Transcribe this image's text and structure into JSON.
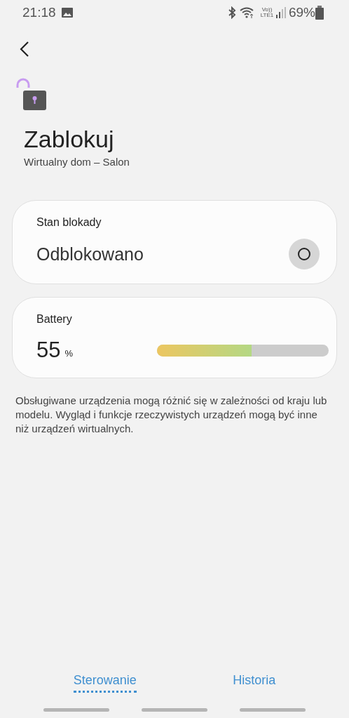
{
  "status_bar": {
    "time": "21:18",
    "network": "Vo)) LTE1",
    "battery": "69%"
  },
  "header": {
    "title": "Zablokuj",
    "subtitle": "Wirtualny dom – Salon",
    "locked": false
  },
  "lock_card": {
    "label": "Stan blokady",
    "value": "Odblokowano",
    "locked": false
  },
  "battery_card": {
    "label": "Battery",
    "value": "55",
    "unit": "%",
    "level": 0.55
  },
  "note": "Obsługiwane urządzenia mogą różnić się w zależności od kraju lub modelu. Wygląd i funkcje rzeczywistych urządzeń mogą być inne niż urządzeń wirtualnych.",
  "tabs": [
    {
      "label": "Sterowanie",
      "selected": true
    },
    {
      "label": "Historia",
      "selected": false
    }
  ]
}
